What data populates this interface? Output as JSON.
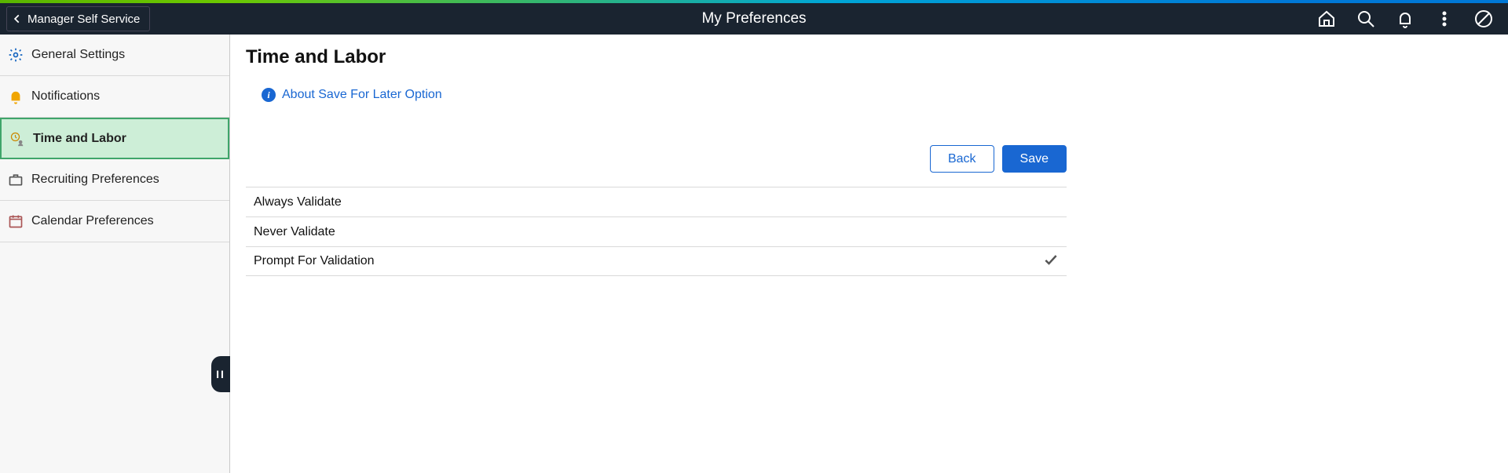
{
  "header": {
    "back_label": "Manager Self Service",
    "title": "My Preferences"
  },
  "sidebar": {
    "items": [
      {
        "label": "General Settings",
        "icon": "gear-icon",
        "selected": false
      },
      {
        "label": "Notifications",
        "icon": "bell-icon",
        "selected": false
      },
      {
        "label": "Time and Labor",
        "icon": "clock-person-icon",
        "selected": true
      },
      {
        "label": "Recruiting Preferences",
        "icon": "briefcase-icon",
        "selected": false
      },
      {
        "label": "Calendar Preferences",
        "icon": "calendar-icon",
        "selected": false
      }
    ]
  },
  "content": {
    "title": "Time and Labor",
    "info_link": "About Save For Later Option",
    "buttons": {
      "back": "Back",
      "save": "Save"
    },
    "options": [
      {
        "label": "Always Validate",
        "selected": false
      },
      {
        "label": "Never Validate",
        "selected": false
      },
      {
        "label": "Prompt For Validation",
        "selected": true
      }
    ]
  }
}
